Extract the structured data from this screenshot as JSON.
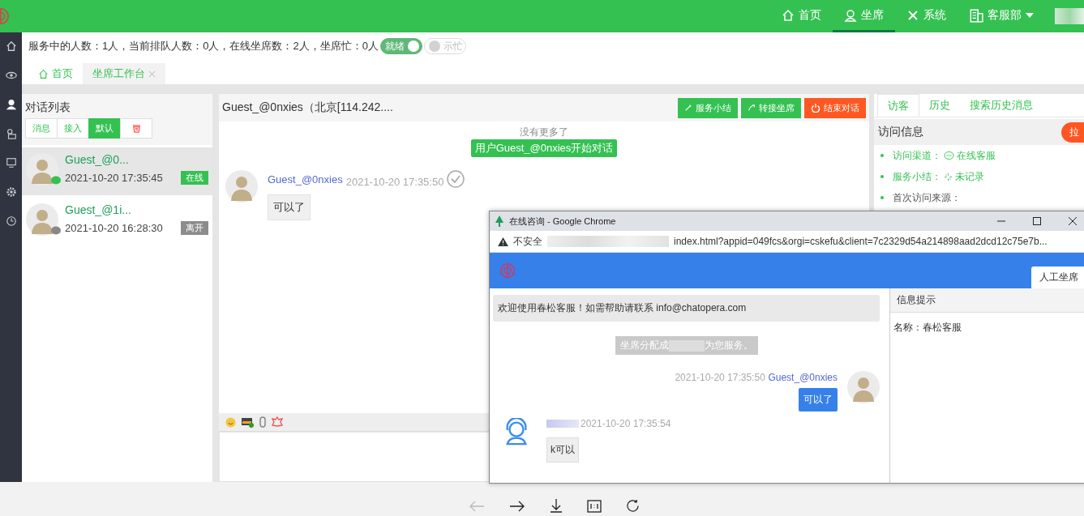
{
  "topbar": {
    "nav": [
      {
        "label": "首页",
        "selected": false
      },
      {
        "label": "坐席",
        "selected": true
      },
      {
        "label": "系统",
        "selected": false
      }
    ],
    "dept": "客服部"
  },
  "status": {
    "text": "服务中的人数：1人，当前排队人数：0人，在线坐席数：2人，坐席忙：0人",
    "toggles": [
      {
        "label": "就绪",
        "on": true
      },
      {
        "label": "示忙",
        "on": false
      }
    ]
  },
  "tabs": [
    {
      "label": "首页",
      "selected": false,
      "closable": false
    },
    {
      "label": "坐席工作台",
      "selected": true,
      "closable": true
    }
  ],
  "conversation_list": {
    "title": "对话列表",
    "filters": [
      {
        "kind": "text",
        "label": "消息",
        "selected": false
      },
      {
        "kind": "text",
        "label": "接入",
        "selected": false
      },
      {
        "kind": "text",
        "label": "默认",
        "selected": true
      },
      {
        "kind": "delete",
        "selected": false
      }
    ],
    "items": [
      {
        "name": "Guest_@0...",
        "time": "2021-10-20 17:35:45",
        "status": "在线",
        "online": true,
        "selected": true
      },
      {
        "name": "Guest_@1i...",
        "time": "2021-10-20 16:28:30",
        "status": "离开",
        "online": false,
        "selected": false
      }
    ]
  },
  "chat": {
    "title": "Guest_@0nxies（北京[114.242....",
    "actions": [
      {
        "kind": "summary",
        "label": "服务小结"
      },
      {
        "kind": "transfer",
        "label": "转接坐席"
      },
      {
        "kind": "end",
        "label": "结束对话"
      }
    ],
    "load_more": "没有更多了",
    "system_message": "用户Guest_@0nxies开始对话",
    "messages": [
      {
        "sender": "Guest_@0nxies",
        "time": "2021-10-20 17:35:50",
        "text": "可以了",
        "read": true
      }
    ]
  },
  "visitor_panel": {
    "tabs": [
      {
        "label": "访客",
        "selected": true
      },
      {
        "label": "历史",
        "selected": false
      },
      {
        "label": "搜索历史消息",
        "selected": false
      }
    ],
    "section_title": "访问信息",
    "blacklist_label": "拉",
    "items": [
      {
        "kind": "channel",
        "label": "访问渠道：",
        "value": "在线客服"
      },
      {
        "kind": "summary",
        "label": "服务小结：",
        "value": "未记录"
      },
      {
        "kind": "plain",
        "label": "首次访问来源："
      }
    ]
  },
  "popup": {
    "title": "在线咨询 - Google Chrome",
    "security_label": "不安全",
    "url": "index.html?appid=049fcs&orgi=cskefu&client=7c2329d54a214898aad2dcd12c75e7b...",
    "header_tab": "人工坐席",
    "messages": [
      {
        "kind": "welcome",
        "text": "欢迎使用春松客服！如需帮助请联系 info@chatopera.com"
      },
      {
        "kind": "system",
        "parts": [
          "坐席分配成",
          "为您服务。"
        ]
      },
      {
        "kind": "outgoing",
        "time": "2021-10-20 17:35:50",
        "sender": "Guest_@0nxies",
        "text": "可以了"
      },
      {
        "kind": "incoming",
        "time": "2021-10-20 17:35:54",
        "text": "k可以"
      }
    ],
    "info_title": "信息提示",
    "info_rows": [
      "名称：春松客服"
    ]
  },
  "viewer": {
    "back_disabled": true
  }
}
